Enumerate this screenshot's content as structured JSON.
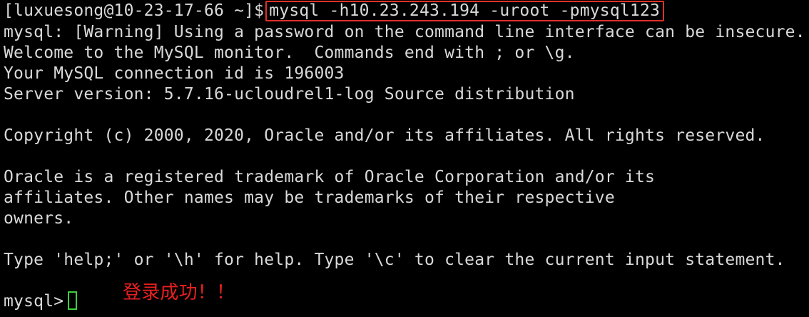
{
  "terminal": {
    "prompt": "[luxuesong@10-23-17-66 ~]$",
    "command": "mysql -h10.23.243.194 -uroot -pmysql123",
    "lines": [
      "mysql: [Warning] Using a password on the command line interface can be insecure.",
      "Welcome to the MySQL monitor.  Commands end with ; or \\g.",
      "Your MySQL connection id is 196003",
      "Server version: 5.7.16-ucloudrel1-log Source distribution",
      "",
      "Copyright (c) 2000, 2020, Oracle and/or its affiliates. All rights reserved.",
      "",
      "Oracle is a registered trademark of Oracle Corporation and/or its",
      "affiliates. Other names may be trademarks of their respective",
      "owners.",
      "",
      "Type 'help;' or '\\h' for help. Type '\\c' to clear the current input statement.",
      ""
    ],
    "mysql_prompt": "mysql>",
    "annotation": "登录成功！！"
  },
  "colors": {
    "background": "#000000",
    "text": "#d9d9d9",
    "highlight_border": "#e0302a",
    "cursor": "#3fcf3f",
    "annotation": "#e8201f"
  }
}
